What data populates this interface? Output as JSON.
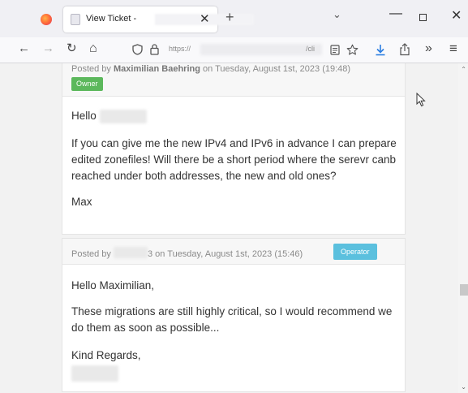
{
  "browser": {
    "tab_title": "View Ticket -",
    "close_glyph": "✕",
    "new_tab_glyph": "+",
    "list_tabs_glyph": "⌄",
    "minimize_glyph": "—",
    "close_window_glyph": "✕",
    "url_visible": "https://",
    "url_tail": "/cli",
    "nav_glyphs": {
      "back": "←",
      "forward": "→",
      "reload": "↻",
      "home": "⌂",
      "more": "»",
      "menu": "≡"
    },
    "icons": [
      "firefox-logo",
      "back-icon",
      "forward-icon",
      "reload-icon",
      "home-icon",
      "tracking-shield-icon",
      "lock-icon",
      "reader-view-icon",
      "bookmark-star-icon",
      "downloads-icon",
      "share-icon",
      "overflow-icon",
      "hamburger-menu-icon"
    ]
  },
  "posts": [
    {
      "meta_prefix": "Posted by",
      "author": "Maximilian Baehring",
      "meta_suffix": "on Tuesday, August 1st, 2023 (19:48)",
      "badge": "Owner",
      "greeting": "Hello",
      "paragraph": "If you can give me the new IPv4 and IPv6 in advance I can prepare edited zonefiles! Will there be a short period where the serevr canb reached under both addresses, the new and old ones?",
      "signature": "Max"
    },
    {
      "meta_prefix": "Posted by",
      "author_tail": "3",
      "meta_suffix": "on Tuesday, August 1st, 2023 (15:46)",
      "badge": "Operator",
      "greeting": "Hello Maximilian,",
      "paragraph": "These migrations are still highly critical, so I would recommend we do them as soon as possible...",
      "closing": "Kind Regards,"
    }
  ],
  "scrollbar": {
    "up_glyph": "⌃",
    "down_glyph": "⌄"
  },
  "colors": {
    "owner_badge": "#5cb85c",
    "operator_badge": "#5bc0de"
  }
}
